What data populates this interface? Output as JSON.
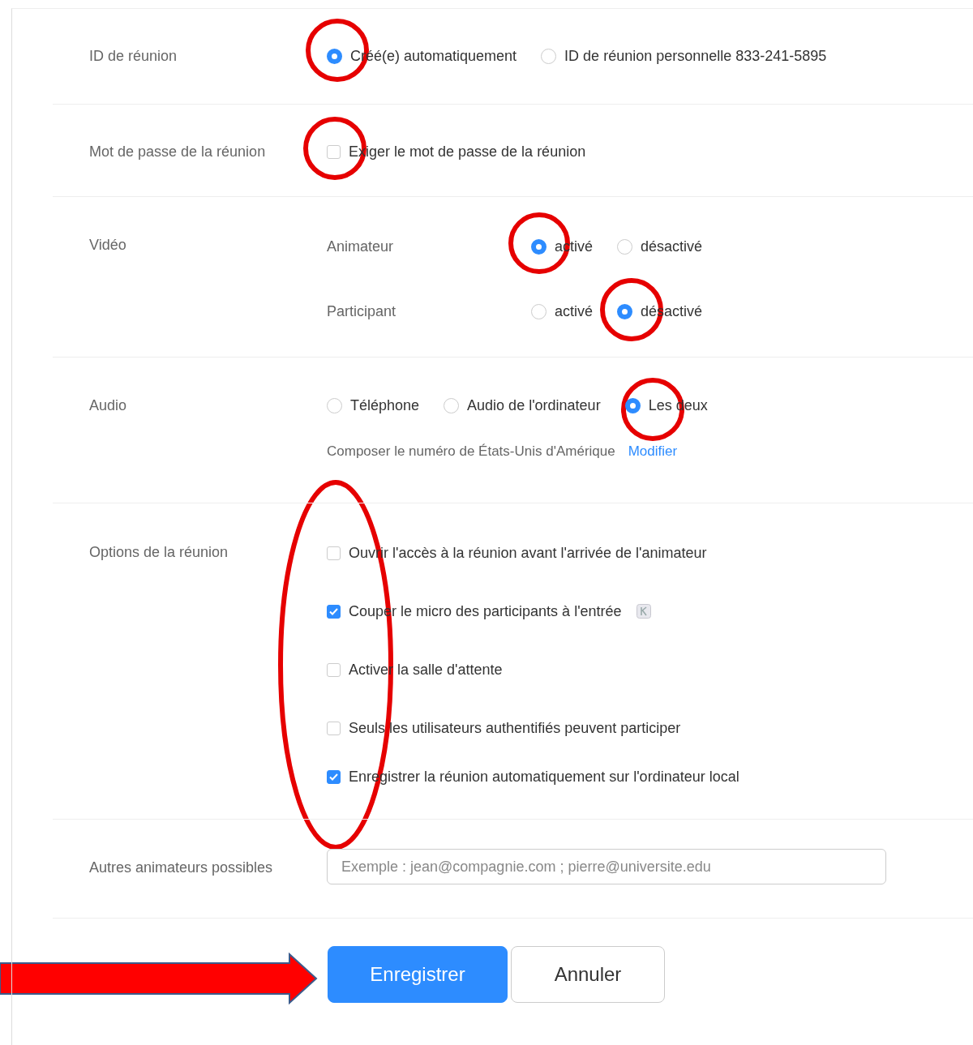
{
  "meeting_id": {
    "label": "ID de réunion",
    "options": [
      {
        "label": "Créé(e) automatiquement",
        "selected": true
      },
      {
        "label": "ID de réunion personnelle 833-241-5895",
        "selected": false
      }
    ]
  },
  "password": {
    "label": "Mot de passe de la réunion",
    "option": {
      "label": "Exiger le mot de passe de la réunion",
      "checked": false
    }
  },
  "video": {
    "label": "Vidéo",
    "rows": [
      {
        "label": "Animateur",
        "options": [
          {
            "label": "activé",
            "selected": true
          },
          {
            "label": "désactivé",
            "selected": false
          }
        ]
      },
      {
        "label": "Participant",
        "options": [
          {
            "label": "activé",
            "selected": false
          },
          {
            "label": "désactivé",
            "selected": true
          }
        ]
      }
    ]
  },
  "audio": {
    "label": "Audio",
    "options": [
      {
        "label": "Téléphone",
        "selected": false
      },
      {
        "label": "Audio de l'ordinateur",
        "selected": false
      },
      {
        "label": "Les deux",
        "selected": true
      }
    ],
    "dial_in": "Composer le numéro de États-Unis d'Amérique",
    "modify_link": "Modifier"
  },
  "meeting_options": {
    "label": "Options de la réunion",
    "items": [
      {
        "label": "Ouvrir l'accès à la réunion avant l'arrivée de l'animateur",
        "checked": false,
        "info": false
      },
      {
        "label": "Couper le micro des participants à l'entrée",
        "checked": true,
        "info": true
      },
      {
        "label": "Activer la salle d'attente",
        "checked": false,
        "info": false
      },
      {
        "label": "Seuls les utilisateurs authentifiés peuvent participer",
        "checked": false,
        "info": false
      },
      {
        "label": "Enregistrer la réunion automatiquement sur l'ordinateur local",
        "checked": true,
        "info": false
      }
    ]
  },
  "alt_hosts": {
    "label": "Autres animateurs possibles",
    "placeholder": "Exemple : jean@compagnie.com ; pierre@universite.edu"
  },
  "buttons": [
    {
      "label": "Enregistrer",
      "kind": "primary"
    },
    {
      "label": "Annuler",
      "kind": "secondary"
    }
  ]
}
